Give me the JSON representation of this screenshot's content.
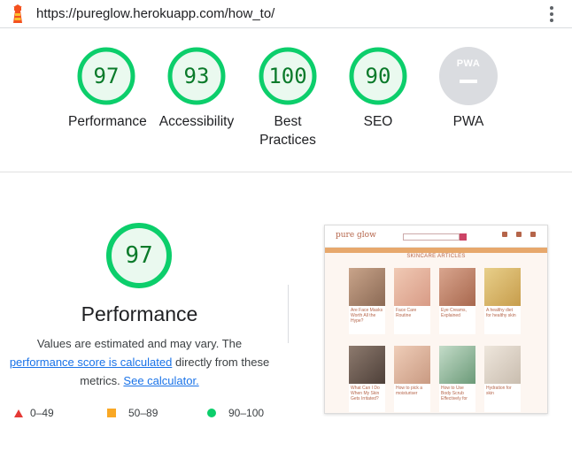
{
  "browser": {
    "url": "https://pureglow.herokuapp.com/how_to/",
    "lighthouse_icon": "lighthouse-icon",
    "menu_icon": "kebab-menu-icon"
  },
  "scores": [
    {
      "value": "97",
      "label": "Performance"
    },
    {
      "value": "93",
      "label": "Accessibility"
    },
    {
      "value": "100",
      "label": "Best Practices"
    },
    {
      "value": "90",
      "label": "SEO"
    },
    {
      "value": "",
      "label": "PWA",
      "badge": "PWA"
    }
  ],
  "performance": {
    "score": "97",
    "title": "Performance",
    "desc_part1": "Values are estimated and may vary. The",
    "link_score": "performance score is calculated",
    "desc_part2": "directly from these metrics.",
    "link_calc": "See calculator."
  },
  "legend": [
    {
      "range": "0–49",
      "shape": "triangle",
      "color": "#e53935"
    },
    {
      "range": "50–89",
      "shape": "square",
      "color": "#f9a825"
    },
    {
      "range": "90–100",
      "shape": "circle",
      "color": "#0cce6b"
    }
  ],
  "screenshot": {
    "brand": "pure glow",
    "section_title": "SKINCARE ARTICLES",
    "cards": [
      "Are Face Masks Worth All the Hype?",
      "Face Care Routine",
      "Eye Creams, Explained",
      "A healthy diet for healthy skin",
      "What Can I Do When My Skin Gets Irritated?",
      "How to pick a moisturiser",
      "How to Use Body Scrub Effectively for",
      "Hydration for skin"
    ]
  },
  "colors": {
    "pass": "#0cce6b",
    "pass_bg": "#eaf9ef",
    "pass_text": "#0a7a2a",
    "pwa_gray": "#dadce0"
  }
}
